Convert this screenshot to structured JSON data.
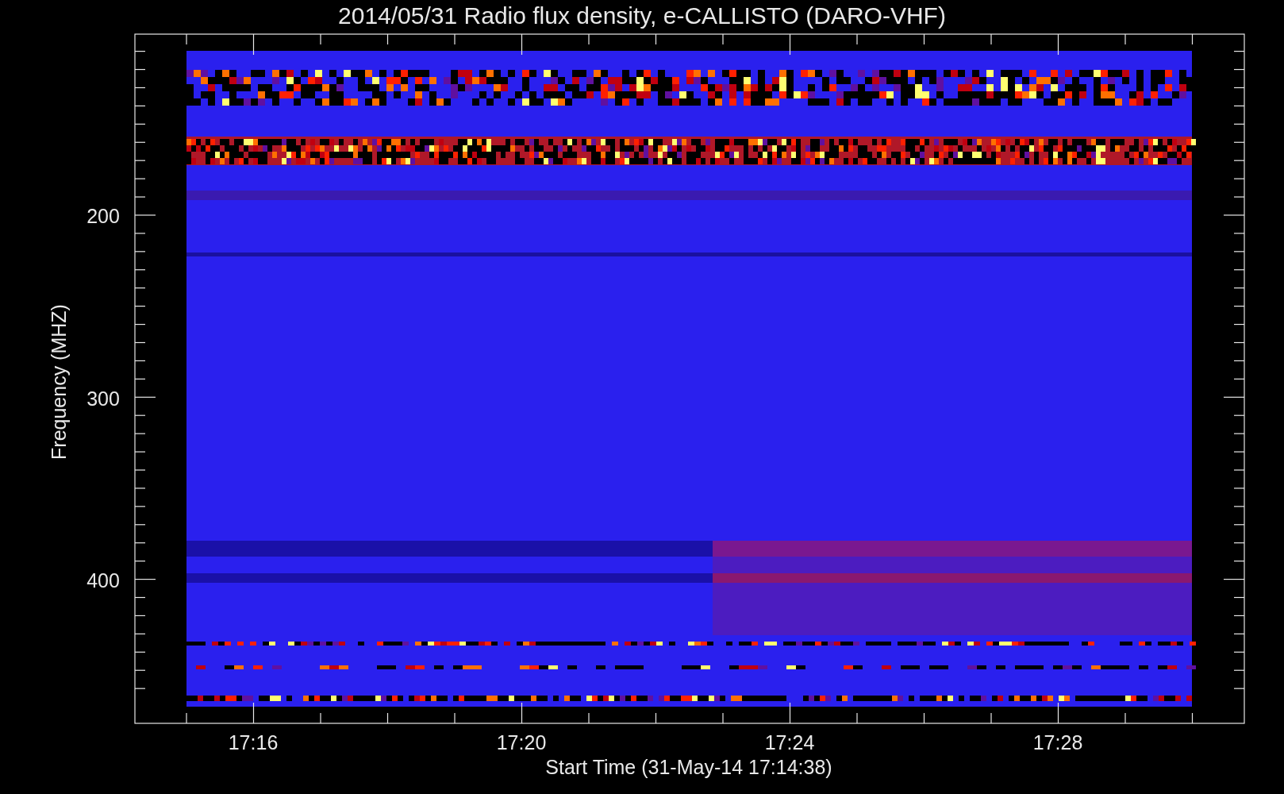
{
  "title": "2014/05/31  Radio flux density, e-CALLISTO (DARO-VHF)",
  "axes": {
    "ylabel": "Frequency (MHZ)",
    "xlabel": "Start Time (31-May-14 17:14:38)",
    "yticks": [
      "200",
      "300",
      "400"
    ],
    "xticks": [
      "17:16",
      "17:20",
      "17:24",
      "17:28"
    ]
  }
}
